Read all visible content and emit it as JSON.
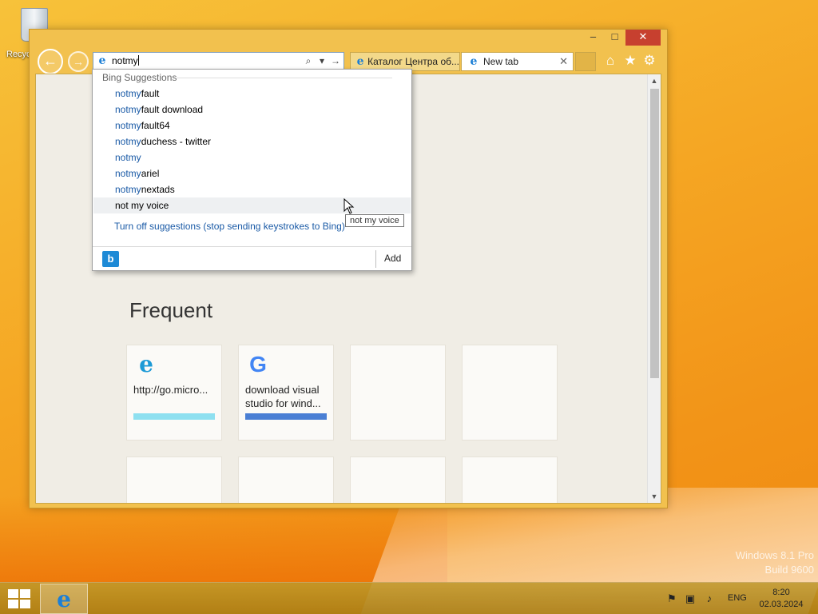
{
  "desktop": {
    "recycle_label": "Recyc",
    "watermark_line1": "Windows 8.1 Pro",
    "watermark_line2": "Build 9600"
  },
  "window": {
    "minimize": "–",
    "maximize": "□",
    "close": "✕",
    "back": "←",
    "forward": "→"
  },
  "address_bar": {
    "value": "notmy",
    "search_glyph": "⌕",
    "dropdown_glyph": "▾",
    "go_glyph": "→"
  },
  "tabs": [
    {
      "label": "Каталог Центра об..."
    },
    {
      "label": "New tab",
      "close": "✕"
    }
  ],
  "toolbar": {
    "home_glyph": "⌂",
    "favorites_glyph": "★",
    "tools_glyph": "⚙"
  },
  "suggestions": {
    "header": "Bing Suggestions",
    "typed": "notmy",
    "items": [
      {
        "typed": "notmy",
        "rest": "fault"
      },
      {
        "typed": "notmy",
        "rest": "fault download"
      },
      {
        "typed": "notmy",
        "rest": "fault64"
      },
      {
        "typed": "notmy",
        "rest": "duchess - twitter"
      },
      {
        "typed": "notmy",
        "rest": ""
      },
      {
        "typed": "notmy",
        "rest": "ariel"
      },
      {
        "typed": "notmy",
        "rest": "nextads"
      },
      {
        "typed": "",
        "rest": "not my voice"
      }
    ],
    "turn_off": "Turn off suggestions (stop sending keystrokes to Bing)",
    "bing_glyph": "b",
    "add_label": "Add",
    "tooltip": "not my voice"
  },
  "new_tab_page": {
    "frequent_title": "Frequent",
    "tiles": [
      {
        "label": "http://go.micro...",
        "icon": "e",
        "bar_color": "#8ee0f0"
      },
      {
        "label": "download visual studio for wind...",
        "icon": "G",
        "bar_color": "#4a7fd4"
      }
    ]
  },
  "taskbar": {
    "language": "ENG",
    "time": "8:20",
    "date": "02.03.2024"
  }
}
